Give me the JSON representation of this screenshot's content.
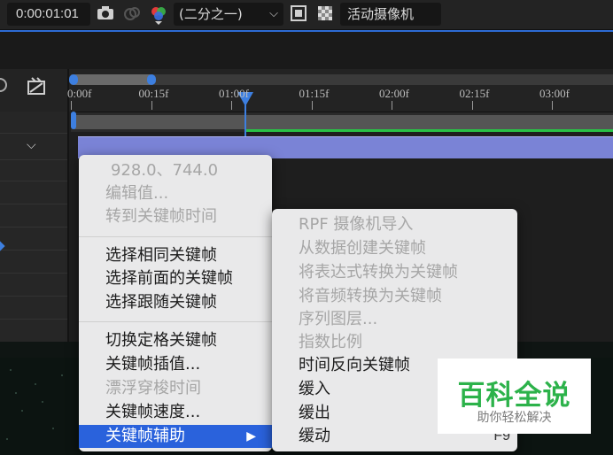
{
  "toolbar": {
    "timecode": "0:00:01:01",
    "resolution": "(二分之一)",
    "camera": "活动摄像机",
    "icons": [
      "camera-snapshot-icon",
      "show-snapshot-icon",
      "color-channels-icon",
      "region-of-interest-icon",
      "transparency-grid-icon"
    ]
  },
  "ruler": {
    "ticks": [
      "0:00f",
      "00:15f",
      "01:00f",
      "01:15f",
      "02:00f",
      "02:15f",
      "03:00f"
    ]
  },
  "context_menu": {
    "items": [
      {
        "label": "928.0、744.0",
        "enabled": false
      },
      {
        "label": "编辑值...",
        "enabled": false
      },
      {
        "label": "转到关键帧时间",
        "enabled": false
      },
      {
        "label": "选择相同关键帧",
        "enabled": true
      },
      {
        "label": "选择前面的关键帧",
        "enabled": true
      },
      {
        "label": "选择跟随关键帧",
        "enabled": true
      },
      {
        "label": "切换定格关键帧",
        "enabled": true
      },
      {
        "label": "关键帧插值...",
        "enabled": true
      },
      {
        "label": "漂浮穿梭时间",
        "enabled": false
      },
      {
        "label": "关键帧速度...",
        "enabled": true
      },
      {
        "label": "关键帧辅助",
        "enabled": true,
        "highlighted": true
      }
    ]
  },
  "submenu": {
    "items": [
      {
        "label": "RPF 摄像机导入",
        "enabled": false
      },
      {
        "label": "从数据创建关键帧",
        "enabled": false
      },
      {
        "label": "将表达式转换为关键帧",
        "enabled": false
      },
      {
        "label": "将音频转换为关键帧",
        "enabled": false
      },
      {
        "label": "序列图层...",
        "enabled": false
      },
      {
        "label": "指数比例",
        "enabled": false
      },
      {
        "label": "时间反向关键帧",
        "enabled": true
      },
      {
        "label": "缓入",
        "enabled": true
      },
      {
        "label": "缓出",
        "enabled": true
      },
      {
        "label": "缓动",
        "enabled": true,
        "shortcut": "F9"
      }
    ]
  },
  "watermark": {
    "title": "百科全说",
    "subtitle": "助你轻松解决"
  },
  "colors": {
    "accent": "#2a62dc",
    "track": "#7a83d6",
    "green": "#29c146"
  }
}
